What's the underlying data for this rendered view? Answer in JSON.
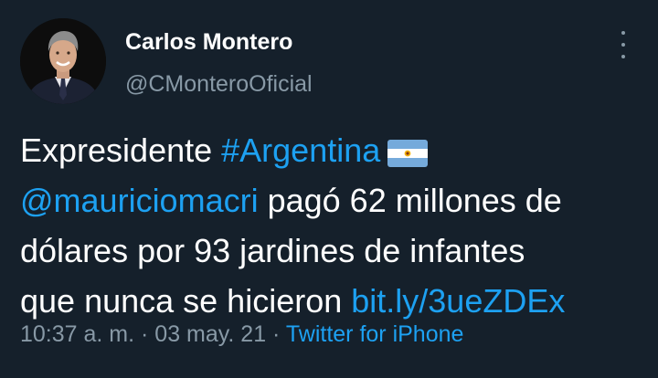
{
  "author": {
    "name": "Carlos Montero",
    "handle": "@CMonteroOficial"
  },
  "tweet": {
    "line1_text": "Expresidente ",
    "line1_hashtag": "#Argentina",
    "line1_emoji": "argentina-flag-emoji",
    "line2_mention": "@mauriciomacri",
    "line2_text": " pagó 62 millones de",
    "line3_text": "dólares por 93 jardines de infantes",
    "line4_text": "que nunca se hicieron ",
    "line4_link": "bit.ly/3ueZDEx"
  },
  "meta": {
    "timestamp": "10:37 a. m. · 03 may. 21 · ",
    "source": "Twitter for iPhone"
  },
  "colors": {
    "background": "#15202b",
    "link": "#1da1f2",
    "secondary_text": "#8899a6",
    "primary_text": "#ffffff"
  },
  "icons": {
    "more": "more-vertical-icon"
  }
}
